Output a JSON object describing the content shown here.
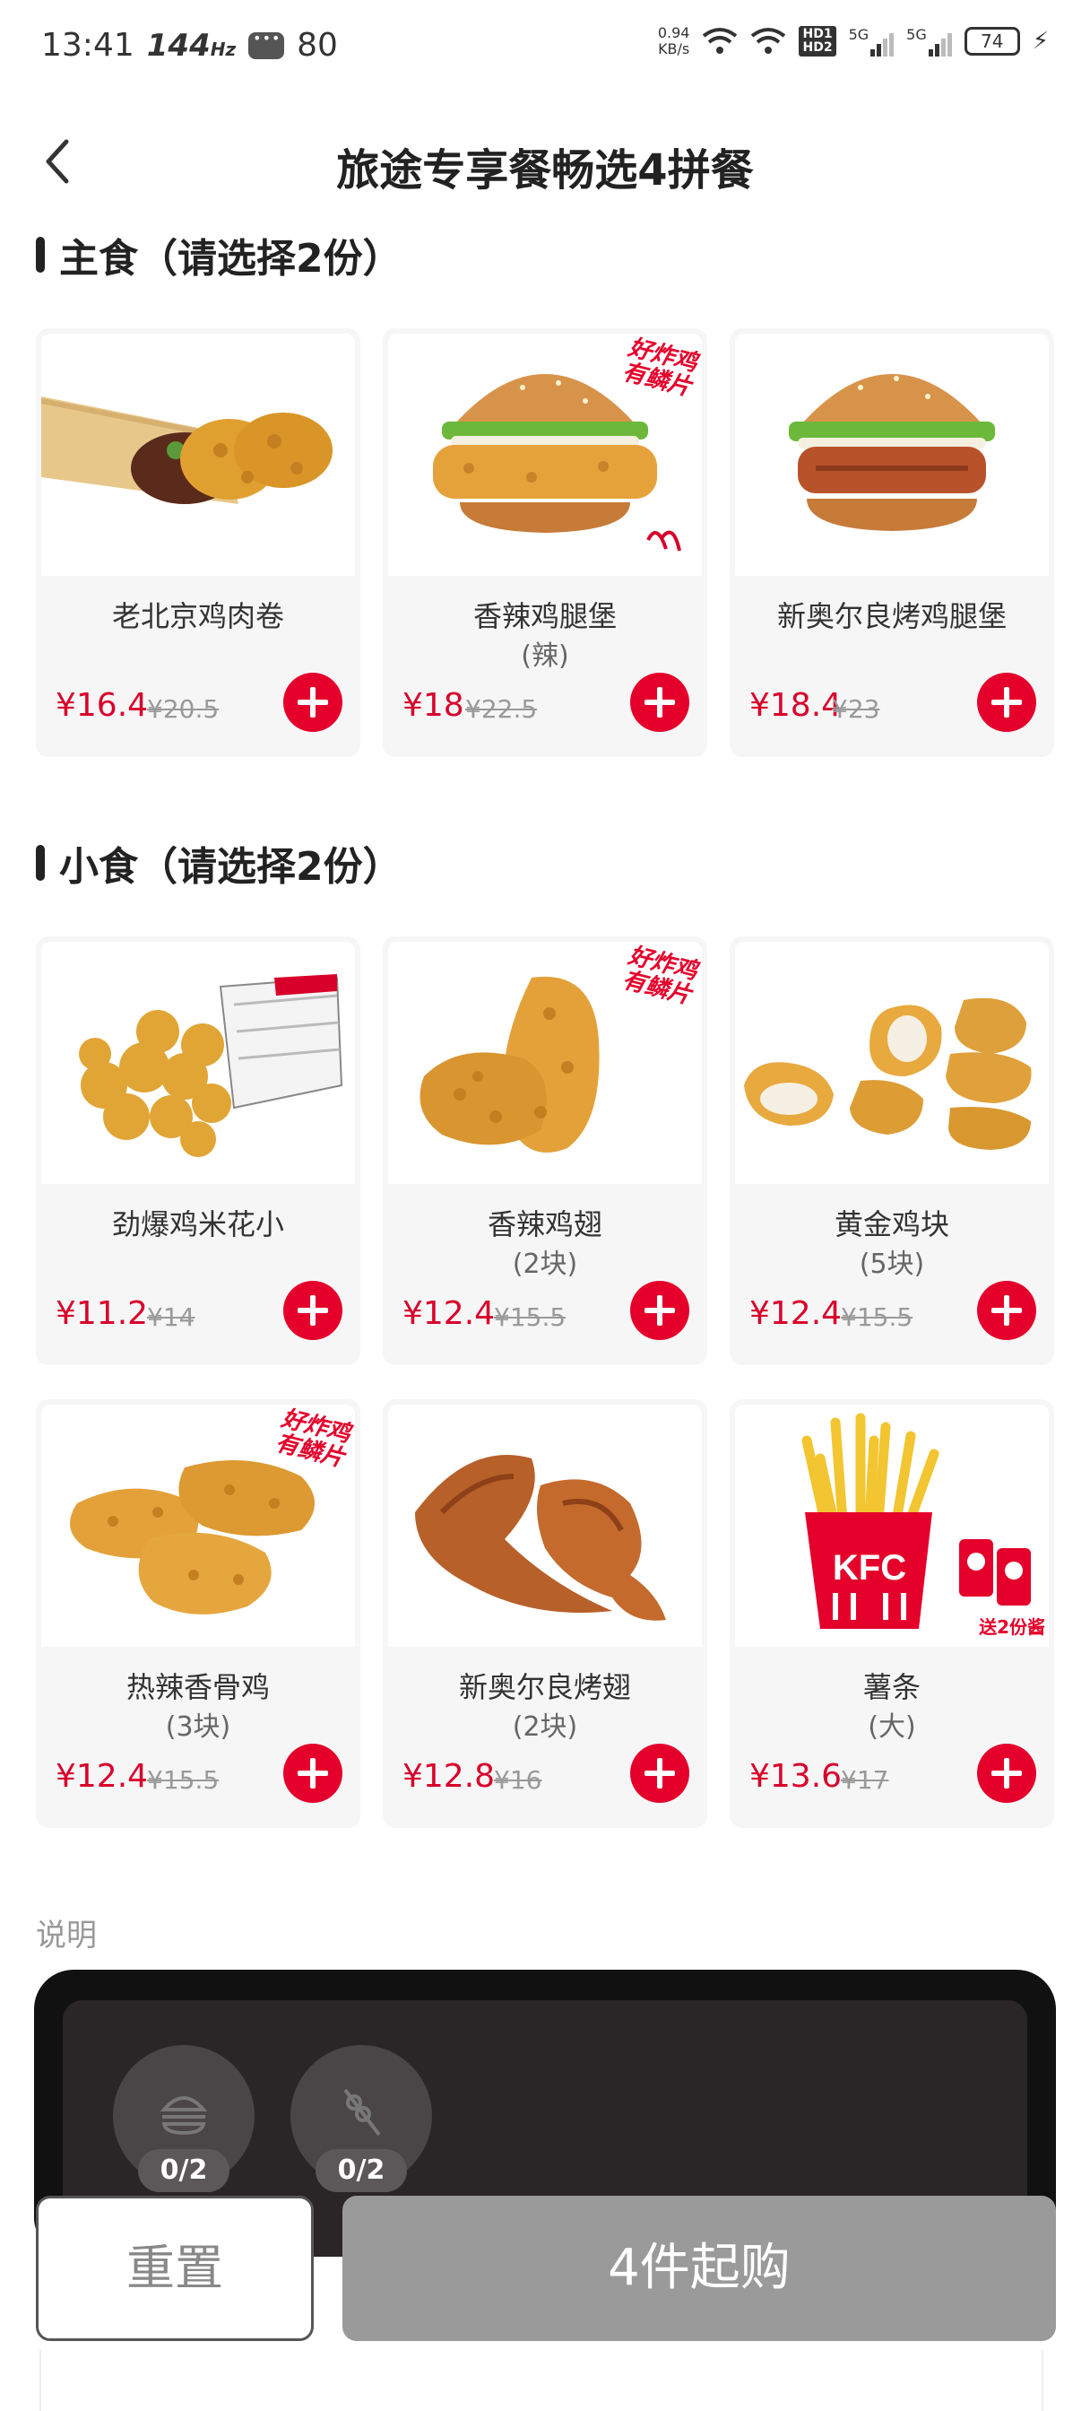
{
  "status_bar": {
    "time": "13:41",
    "refresh_rate": "144",
    "refresh_unit": "Hz",
    "notification_count": "80",
    "net_speed_value": "0.94",
    "net_speed_unit": "KB/s",
    "hd1": "HD1",
    "hd2": "HD2",
    "sim1": "5G",
    "sim2": "5G",
    "battery": "74"
  },
  "header": {
    "title": "旅途专享餐畅选4拼餐"
  },
  "sections": [
    {
      "title": "主食（请选择2份）",
      "items": [
        {
          "name": "老北京鸡肉卷",
          "sub": "",
          "price": "¥16.4",
          "original_price": "¥20.5",
          "image": "chicken-wrap",
          "promo": false
        },
        {
          "name": "香辣鸡腿堡",
          "sub": "(辣)",
          "price": "¥18",
          "original_price": "¥22.5",
          "image": "spicy-burger",
          "promo": true
        },
        {
          "name": "新奥尔良烤鸡腿堡",
          "sub": "",
          "price": "¥18.4",
          "original_price": "¥23",
          "image": "orleans-burger",
          "promo": false
        }
      ]
    },
    {
      "title": "小食（请选择2份）",
      "items": [
        {
          "name": "劲爆鸡米花小",
          "sub": "",
          "price": "¥11.2",
          "original_price": "¥14",
          "image": "popcorn-chicken",
          "promo": false
        },
        {
          "name": "香辣鸡翅",
          "sub": "(2块)",
          "price": "¥12.4",
          "original_price": "¥15.5",
          "image": "spicy-wings",
          "promo": true
        },
        {
          "name": "黄金鸡块",
          "sub": "(5块)",
          "price": "¥12.4",
          "original_price": "¥15.5",
          "image": "nuggets",
          "promo": false
        },
        {
          "name": "热辣香骨鸡",
          "sub": "(3块)",
          "price": "¥12.4",
          "original_price": "¥15.5",
          "image": "hot-chicken",
          "promo": true
        },
        {
          "name": "新奥尔良烤翅",
          "sub": "(2块)",
          "price": "¥12.8",
          "original_price": "¥16",
          "image": "orleans-wings",
          "promo": false
        },
        {
          "name": "薯条",
          "sub": "(大)",
          "price": "¥13.6",
          "original_price": "¥17",
          "image": "fries",
          "promo": false
        }
      ]
    }
  ],
  "promo_tag": {
    "line1": "好炸鸡",
    "line2": "有鳞片"
  },
  "fries_tag": "送2份酱",
  "fries_box_text": "KFC",
  "description_label": "说明",
  "tray": {
    "main_count": "0/2",
    "side_count": "0/2"
  },
  "buttons": {
    "reset": "重置",
    "buy": "4件起购"
  },
  "colors": {
    "brand_red": "#e4002b",
    "price_red": "#d8002a",
    "disabled_gray": "#9a9a9a"
  }
}
